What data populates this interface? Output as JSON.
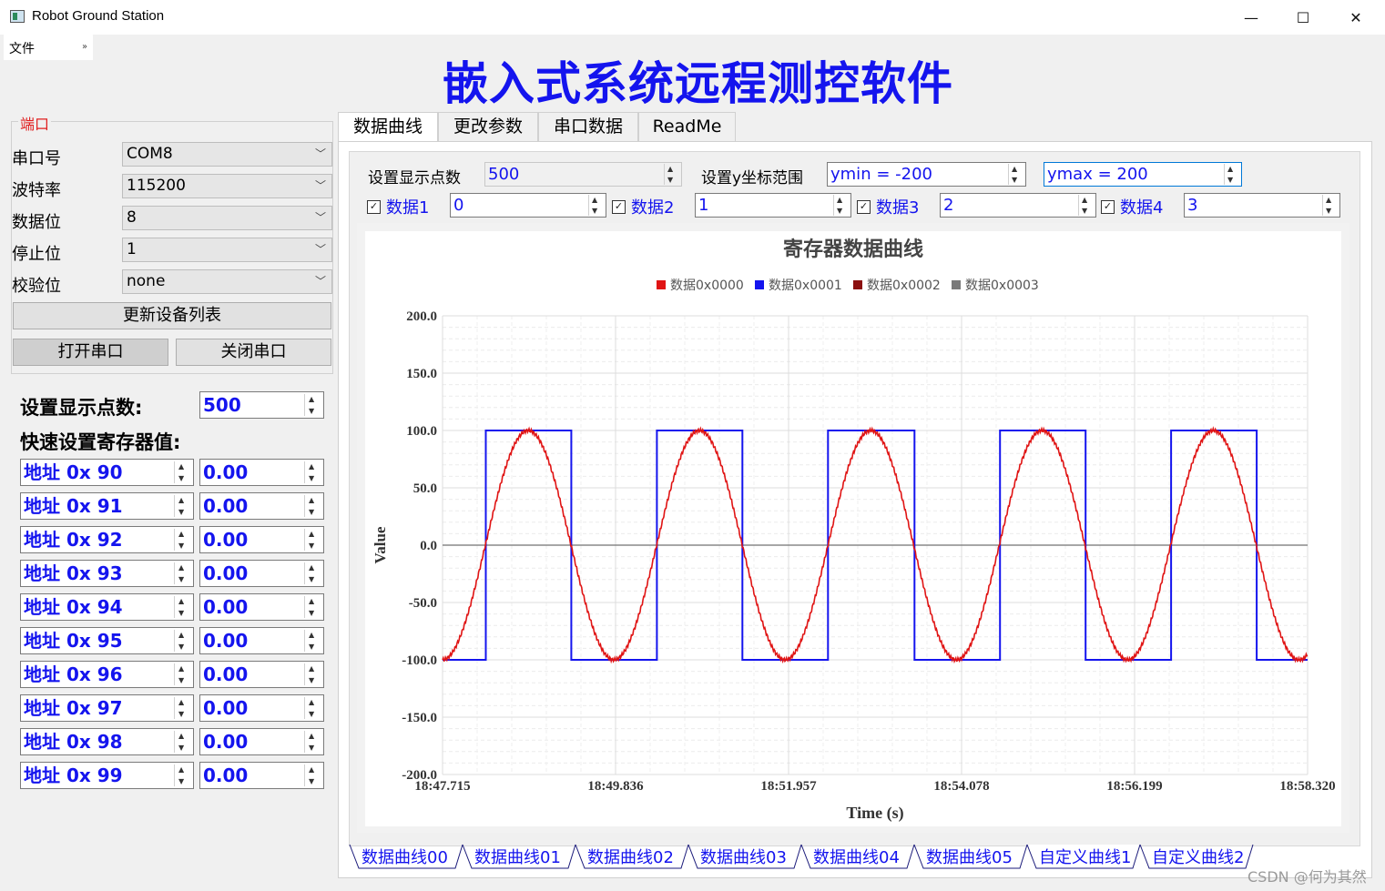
{
  "window": {
    "title": "Robot Ground Station",
    "controls": {
      "minimize": "—",
      "maximize": "☐",
      "close": "✕"
    }
  },
  "menu": {
    "file": "文件",
    "more": "»"
  },
  "heading": "嵌入式系统远程测控软件",
  "port": {
    "group_title": "端口",
    "fields": [
      {
        "label": "串口号",
        "value": "COM8"
      },
      {
        "label": "波特率",
        "value": "115200"
      },
      {
        "label": "数据位",
        "value": "8"
      },
      {
        "label": "停止位",
        "value": "1"
      },
      {
        "label": "校验位",
        "value": "none"
      }
    ],
    "refresh_button": "更新设备列表",
    "open_button": "打开串口",
    "close_button": "关闭串口"
  },
  "quick": {
    "points_label": "设置显示点数:",
    "points_value": "500",
    "registers_label": "快速设置寄存器值:",
    "registers": [
      {
        "address": "地址 0x 90",
        "value": "0.00"
      },
      {
        "address": "地址 0x 91",
        "value": "0.00"
      },
      {
        "address": "地址 0x 92",
        "value": "0.00"
      },
      {
        "address": "地址 0x 93",
        "value": "0.00"
      },
      {
        "address": "地址 0x 94",
        "value": "0.00"
      },
      {
        "address": "地址 0x 95",
        "value": "0.00"
      },
      {
        "address": "地址 0x 96",
        "value": "0.00"
      },
      {
        "address": "地址 0x 97",
        "value": "0.00"
      },
      {
        "address": "地址 0x 98",
        "value": "0.00"
      },
      {
        "address": "地址 0x 99",
        "value": "0.00"
      }
    ]
  },
  "tabs": [
    "数据曲线",
    "更改参数",
    "串口数据",
    "ReadMe"
  ],
  "controls": {
    "points_label": "设置显示点数",
    "points_value": "500",
    "yrange_label": "设置y坐标范围",
    "ymin": "ymin = -200",
    "ymax": "ymax = 200",
    "channels": [
      {
        "label": "数据1",
        "value": "0"
      },
      {
        "label": "数据2",
        "value": "1"
      },
      {
        "label": "数据3",
        "value": "2"
      },
      {
        "label": "数据4",
        "value": "3"
      }
    ]
  },
  "curve_tabs": [
    "数据曲线00",
    "数据曲线01",
    "数据曲线02",
    "数据曲线03",
    "数据曲线04",
    "数据曲线05",
    "自定义曲线1",
    "自定义曲线2"
  ],
  "watermark": "CSDN @何为其然",
  "colors": {
    "accent": "#1414ee",
    "red_series": "#e01414",
    "blue_series": "#1414ee"
  },
  "chart_data": {
    "type": "line",
    "title": "寄存器数据曲线",
    "xlabel": "Time (s)",
    "ylabel": "Value",
    "ylim": [
      -200,
      200
    ],
    "yticks": [
      "200.0",
      "150.0",
      "100.0",
      "50.0",
      "0.0",
      "-50.0",
      "-100.0",
      "-150.0",
      "-200.0"
    ],
    "xticks": [
      "18:47.715",
      "18:49.836",
      "18:51.957",
      "18:54.078",
      "18:56.199",
      "18:58.320"
    ],
    "grid": true,
    "legend_position": "top-center",
    "legend": [
      {
        "name": "数据0x0000",
        "color": "#e01414"
      },
      {
        "name": "数据0x0001",
        "color": "#1414ee"
      },
      {
        "name": "数据0x0002",
        "color": "#8b1010"
      },
      {
        "name": "数据0x0003",
        "color": "#7a7a7a"
      }
    ],
    "series": [
      {
        "name": "数据0x0000",
        "kind": "sine",
        "amplitude": 100,
        "period_s": 2.1,
        "phase_start": "trough",
        "color": "#e01414"
      },
      {
        "name": "数据0x0001",
        "kind": "square",
        "high": 100,
        "low": -100,
        "period_s": 2.1,
        "color": "#1414ee"
      },
      {
        "name": "数据0x0002",
        "kind": "zero",
        "value": 0,
        "color": "#8b1010"
      },
      {
        "name": "数据0x0003",
        "kind": "zero",
        "value": 0,
        "color": "#7a7a7a"
      }
    ]
  }
}
